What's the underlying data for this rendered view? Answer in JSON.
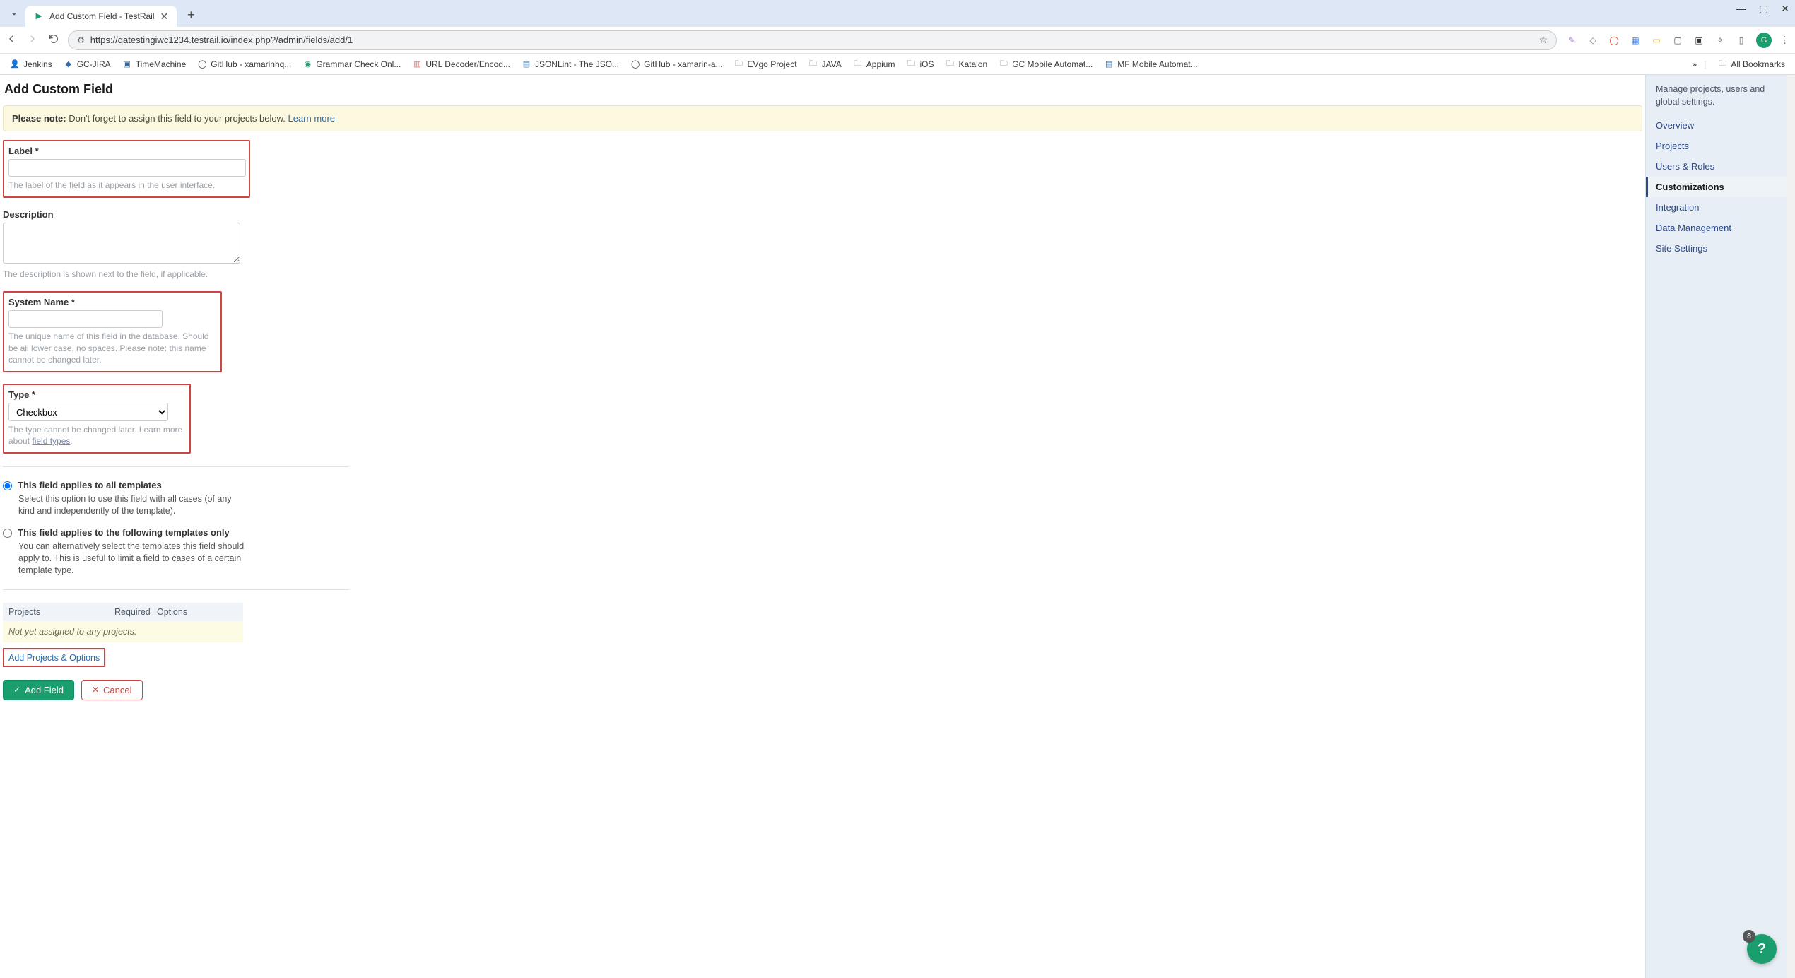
{
  "browser": {
    "tab_title": "Add Custom Field - TestRail",
    "url": "https://qatestingiwc1234.testrail.io/index.php?/admin/fields/add/1",
    "avatar_letter": "G",
    "all_bookmarks_label": "All Bookmarks",
    "bookmarks": [
      {
        "label": "Jenkins"
      },
      {
        "label": "GC-JIRA"
      },
      {
        "label": "TimeMachine"
      },
      {
        "label": "GitHub - xamarinhq..."
      },
      {
        "label": "Grammar Check Onl..."
      },
      {
        "label": "URL Decoder/Encod..."
      },
      {
        "label": "JSONLint - The JSO..."
      },
      {
        "label": "GitHub - xamarin-a..."
      },
      {
        "label": "EVgo Project"
      },
      {
        "label": "JAVA"
      },
      {
        "label": "Appium"
      },
      {
        "label": "iOS"
      },
      {
        "label": "Katalon"
      },
      {
        "label": "GC Mobile Automat..."
      },
      {
        "label": "MF Mobile Automat..."
      }
    ]
  },
  "page": {
    "title": "Add Custom Field",
    "notice_bold": "Please note:",
    "notice_text": " Don't forget to assign this field to your projects below. ",
    "notice_link": "Learn more"
  },
  "form": {
    "label": {
      "label": "Label *",
      "value": "",
      "hint": "The label of the field as it appears in the user interface."
    },
    "description": {
      "label": "Description",
      "value": "",
      "hint": "The description is shown next to the field, if applicable."
    },
    "system_name": {
      "label": "System Name *",
      "value": "",
      "hint": "The unique name of this field in the database. Should be all lower case, no spaces. Please note: this name cannot be changed later."
    },
    "type": {
      "label": "Type *",
      "value": "Checkbox",
      "hint_pre": "The type cannot be changed later. Learn more about ",
      "hint_link": "field types"
    },
    "templates": {
      "opt_all_title": "This field applies to all templates",
      "opt_all_desc": "Select this option to use this field with all cases (of any kind and independently of the template).",
      "opt_sel_title": "This field applies to the following templates only",
      "opt_sel_desc": "You can alternatively select the templates this field should apply to. This is useful to limit a field to cases of a certain template type."
    },
    "projects": {
      "col_projects": "Projects",
      "col_required": "Required",
      "col_options": "Options",
      "empty": "Not yet assigned to any projects.",
      "add_link": "Add Projects & Options"
    },
    "buttons": {
      "add": "Add Field",
      "cancel": "Cancel"
    }
  },
  "sidebar": {
    "note": "Manage projects, users and global settings.",
    "items": [
      {
        "label": "Overview"
      },
      {
        "label": "Projects"
      },
      {
        "label": "Users & Roles"
      },
      {
        "label": "Customizations",
        "active": true
      },
      {
        "label": "Integration"
      },
      {
        "label": "Data Management"
      },
      {
        "label": "Site Settings"
      }
    ]
  },
  "fab": {
    "badge": "8"
  }
}
